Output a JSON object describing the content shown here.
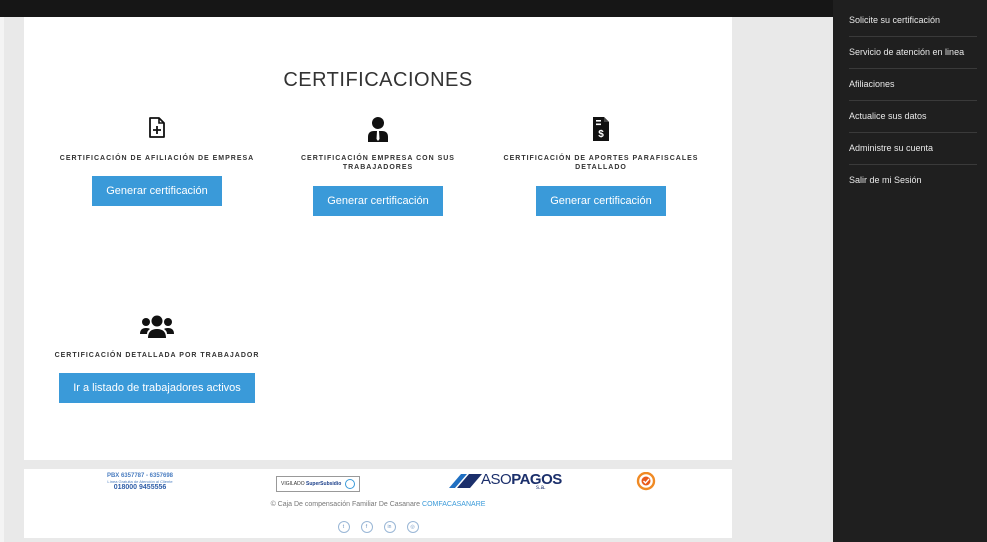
{
  "page": {
    "title": "CERTIFICACIONES"
  },
  "cards": [
    {
      "title": "CERTIFICACIÓN DE AFILIACIÓN DE EMPRESA",
      "button": "Generar certificación",
      "icon": "document-plus-icon"
    },
    {
      "title": "CERTIFICACIÓN EMPRESA CON SUS TRABAJADORES",
      "button": "Generar certificación",
      "icon": "user-tie-icon"
    },
    {
      "title": "CERTIFICACIÓN DE APORTES PARAFISCALES DETALLADO",
      "button": "Generar certificación",
      "icon": "invoice-dollar-icon"
    },
    {
      "title": "CERTIFICACIÓN DETALLADA POR TRABAJADOR",
      "button": "Ir a listado de trabajadores activos",
      "icon": "users-icon"
    }
  ],
  "sidebar": {
    "items": [
      {
        "label": "Solicite su certificación"
      },
      {
        "label": "Servicio de atención en linea"
      },
      {
        "label": "Afiliaciones"
      },
      {
        "label": "Actualice sus datos"
      },
      {
        "label": "Administre su cuenta"
      },
      {
        "label": "Salir de mi Sesión"
      }
    ]
  },
  "footer": {
    "pbx_line1": "PBX 6357787 - 6357698",
    "pbx_line2": "Línea Gratuita de Atención al Cliente",
    "pbx_line3": "018000 9455556",
    "vigilado_prefix": "VIGILADO",
    "vigilado_brand": "SuperSubsidio",
    "asopagos_a": "ASO",
    "asopagos_b": "PAGOS",
    "asopagos_sa": "s.a.",
    "copyright": "© Caja De compensación Familiar De Casanare",
    "copyright_link": "COMFACASANARE",
    "socials": [
      "twitter-icon",
      "facebook-icon",
      "linkedin-icon",
      "instagram-icon"
    ],
    "colors": {
      "accent": "#3a9ad9",
      "sidebar": "#1f1f1f"
    }
  }
}
